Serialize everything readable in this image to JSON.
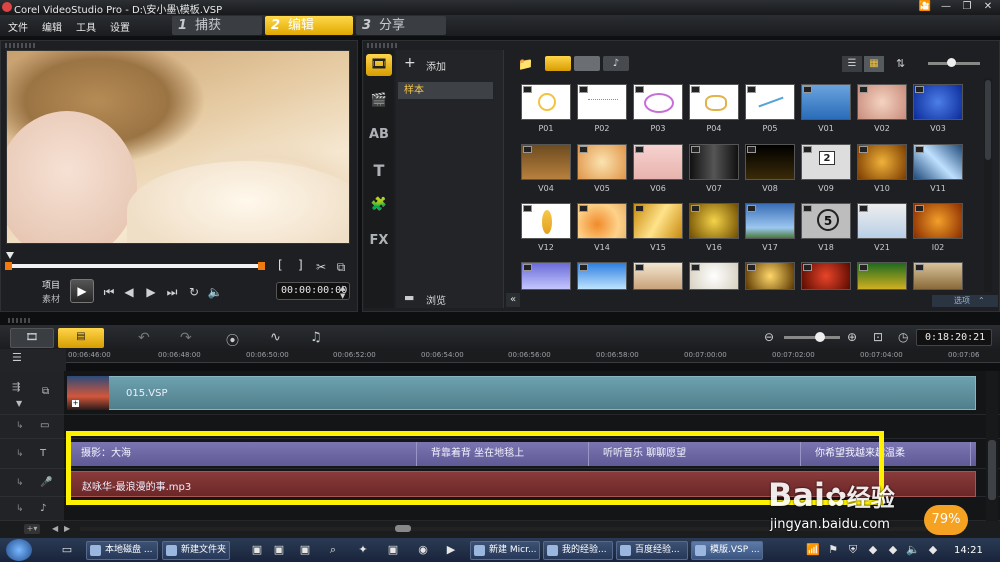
{
  "window": {
    "title": "Corel VideoStudio Pro - D:\\安小墨\\模板.VSP",
    "controls": [
      "🎦",
      "—",
      "❐",
      "✕"
    ]
  },
  "menu": [
    "文件",
    "编辑",
    "工具",
    "设置"
  ],
  "steps": [
    {
      "num": "1",
      "label": "捕获",
      "active": false
    },
    {
      "num": "2",
      "label": "编辑",
      "active": true
    },
    {
      "num": "3",
      "label": "分享",
      "active": false
    }
  ],
  "player": {
    "mode_project": "项目",
    "mode_clip": "素材",
    "timecode": "00:00:00:00",
    "trim_in": "[",
    "trim_out": "]"
  },
  "library": {
    "add_label": "添加",
    "folder_item": "样本",
    "browse_label": "浏览",
    "options_label": "选项",
    "side_icons": [
      "🎞",
      "🎬",
      "AB",
      "T",
      "🧩",
      "FX"
    ],
    "thumbnails": [
      [
        "P01",
        "P02",
        "P03",
        "P04",
        "P05",
        "V01",
        "V02",
        "V03"
      ],
      [
        "V04",
        "V05",
        "V06",
        "V07",
        "V08",
        "V09",
        "V10",
        "V11"
      ],
      [
        "V12",
        "V14",
        "V15",
        "V16",
        "V17",
        "V18",
        "V21",
        "I02"
      ],
      [
        "",
        "",
        "",
        "",
        "",
        "",
        "",
        ""
      ]
    ]
  },
  "timeline": {
    "total_time": "0:18:20:21",
    "ruler_ticks": [
      "00:06:46:00",
      "00:06:48:00",
      "00:06:50:00",
      "00:06:52:00",
      "00:06:54:00",
      "00:06:56:00",
      "00:06:58:00",
      "00:07:00:00",
      "00:07:02:00",
      "00:07:04:00",
      "00:07:06"
    ],
    "video_clip": "015.VSP",
    "title_segments": [
      "摄影：大海",
      "背靠着背 坐在地毯上",
      "听听音乐 聊聊愿望",
      "你希望我越来越温柔"
    ],
    "music_clip": "赵咏华-最浪漫的事.mp3"
  },
  "watermark": {
    "brand": "Bai",
    "brand_cn": "经验",
    "url": "jingyan.baidu.com",
    "percent": "79%"
  },
  "taskbar": {
    "items": [
      "本地磁盘 ...",
      "新建文件夹",
      "新建 Micr...",
      "我的经验...",
      "百度经验...",
      "模版.VSP ..."
    ],
    "clock": "14:21"
  }
}
